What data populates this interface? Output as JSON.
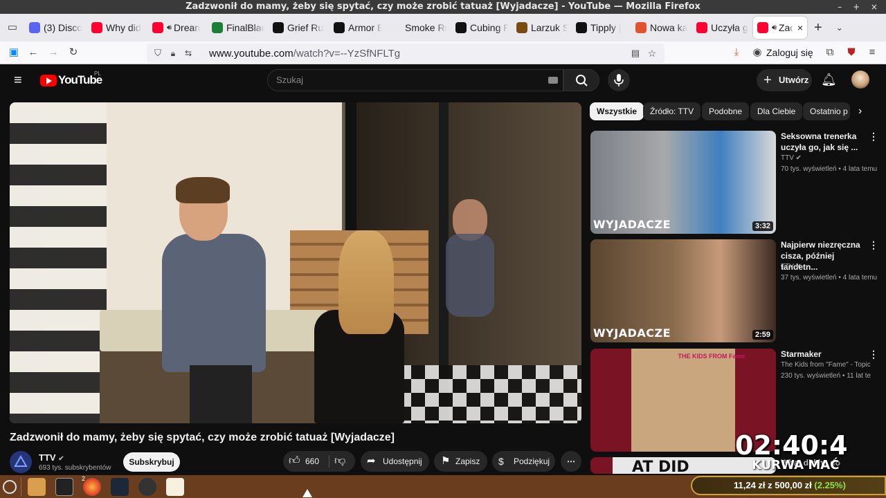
{
  "window": {
    "title": "Zadzwonił do mamy, żeby się spytać, czy może zrobić tatuaż [Wyjadacze] - YouTube — Mozilla Firefox"
  },
  "tabs": [
    {
      "label": "(3) Disco",
      "color": "#5865f2",
      "icon": "discord-icon"
    },
    {
      "label": "Why did",
      "color": "#ff0033",
      "icon": "youtube-icon"
    },
    {
      "label": "Drean",
      "color": "#ff0033",
      "icon": "youtube-icon",
      "audio": true
    },
    {
      "label": "FinalBlac",
      "color": "#1a7f37",
      "icon": "k-icon"
    },
    {
      "label": "Grief Ru",
      "color": "#111111",
      "icon": "steam-icon"
    },
    {
      "label": "Armor B",
      "color": "#111111",
      "icon": "steam-icon"
    },
    {
      "label": "Smoke Run",
      "color": "",
      "icon": "blank-icon"
    },
    {
      "label": "Cubing F",
      "color": "#111111",
      "icon": "steam-icon"
    },
    {
      "label": "Larzuk S",
      "color": "#7a4a13",
      "icon": "wiki-icon"
    },
    {
      "label": "Tipply |",
      "color": "#111111",
      "icon": "tipply-icon"
    },
    {
      "label": "Nowa ka",
      "color": "#e2532d",
      "icon": "firefox-icon"
    },
    {
      "label": "Uczyła g",
      "color": "#ff0033",
      "icon": "youtube-icon"
    },
    {
      "label": "Zad",
      "color": "#ff0033",
      "icon": "youtube-icon",
      "audio": true,
      "active": true
    }
  ],
  "nav": {
    "url_host": "www.youtube.com",
    "url_path": "/watch?v=--YzSfNFLTg",
    "signin": "Zaloguj się"
  },
  "yt": {
    "logo": "YouTube",
    "region": "PL",
    "search_placeholder": "Szukaj",
    "create_label": "Utwórz"
  },
  "chips": [
    "Wszystkie",
    "Źródło: TTV",
    "Podobne",
    "Dla Ciebie",
    "Ostatnio p"
  ],
  "related": [
    {
      "title": "Seksowna trenerka uczyła go, jak się ...",
      "channel": "TTV",
      "meta": "70 tys. wyświetleń • 4 lata temu",
      "duration": "3:32",
      "brand": "WYJADACZE"
    },
    {
      "title": "Najpierw niezręczna cisza, później tandetn...",
      "channel": "TTV",
      "meta": "37 tys. wyświetleń • 4 lata temu",
      "duration": "2:59",
      "brand": "WYJADACZE"
    },
    {
      "title": "Starmaker",
      "channel": "The Kids from \"Fame\" - Topic",
      "meta": "230 tys. wyświetleń • 11 lat te",
      "cover_text": "THE KIDS FROM Fame"
    },
    {
      "title": "What did he do",
      "channel": "",
      "meta": "",
      "partial": "AT DID"
    }
  ],
  "video": {
    "title": "Zadzwonił do mamy, żeby się spytać, czy może zrobić tatuaż [Wyjadacze]",
    "channel": "TTV",
    "subscribers": "693 tys. subskrybentów",
    "subscribe_label": "Subskrybuj",
    "likes": "660",
    "share": "Udostępnij",
    "save": "Zapisz",
    "thanks": "Podziękuj"
  },
  "overlay": {
    "timer": "02:40:4",
    "caption": "KURWA MAĆ",
    "goal_current": "11,24 zł",
    "goal_sep": " z ",
    "goal_target": "500,00 zł",
    "goal_pct": "(2.25%)"
  },
  "taskbar": {
    "firefox_badge": "2"
  }
}
